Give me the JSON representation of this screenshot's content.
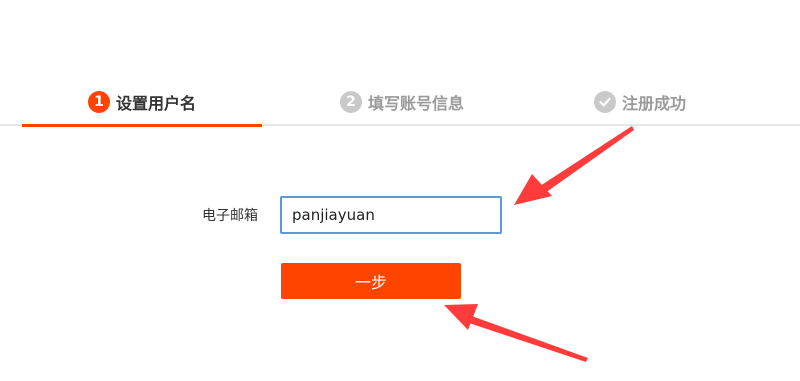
{
  "steps": [
    {
      "number": "1",
      "label": "设置用户名",
      "state": "active"
    },
    {
      "number": "2",
      "label": "填写账号信息",
      "state": "inactive"
    },
    {
      "number": "",
      "label": "注册成功",
      "state": "inactive",
      "icon": "check-icon"
    }
  ],
  "form": {
    "email_label": "电子邮箱",
    "email_value": "panjiayuan",
    "next_label": "一步"
  },
  "colors": {
    "accent": "#ff4400",
    "inactive": "#c9c9c9",
    "input_border": "#5a9ad6",
    "annotation_arrow": "#ff3b3b"
  }
}
